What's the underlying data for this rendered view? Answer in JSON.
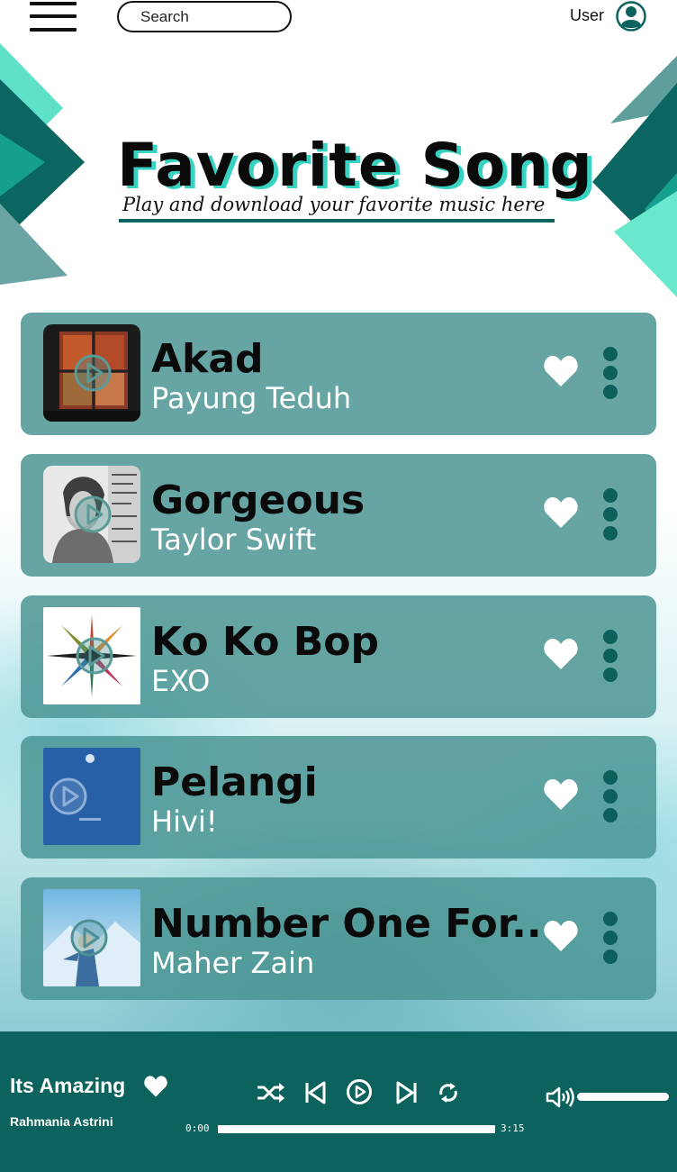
{
  "header": {
    "search_placeholder": "Search",
    "user_label": "User"
  },
  "hero": {
    "title": "Favorite Song",
    "subtitle": "Play and download your favorite music here"
  },
  "songs": [
    {
      "title": "Akad",
      "artist": "Payung Teduh"
    },
    {
      "title": "Gorgeous",
      "artist": "Taylor Swift"
    },
    {
      "title": "Ko Ko Bop",
      "artist": "EXO"
    },
    {
      "title": "Pelangi",
      "artist": "Hivi!"
    },
    {
      "title": "Number One For..",
      "artist": "Maher Zain"
    }
  ],
  "player": {
    "title": "Its Amazing",
    "artist": "Rahmania Astrini",
    "time_current": "0:00",
    "time_total": "3:15",
    "progress": 0.0
  },
  "icons": {
    "menu": "hamburger-icon",
    "user": "user-icon",
    "play": "play-icon",
    "heart": "heart-icon",
    "more": "more-vertical-icon",
    "shuffle": "shuffle-icon",
    "previous": "skip-back-icon",
    "next": "skip-forward-icon",
    "repeat": "repeat-icon",
    "volume": "volume-icon"
  },
  "colors": {
    "card": "#4a9492",
    "player": "#0c625d",
    "accent": "#38d2c2",
    "dark_teal": "#0b6560"
  }
}
